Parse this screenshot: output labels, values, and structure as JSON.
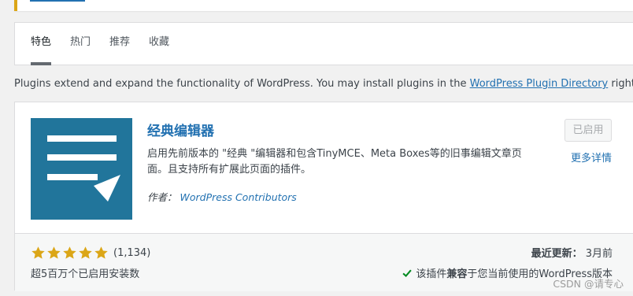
{
  "tabs": [
    {
      "label": "特色",
      "active": true
    },
    {
      "label": "热门",
      "active": false
    },
    {
      "label": "推荐",
      "active": false
    },
    {
      "label": "收藏",
      "active": false
    }
  ],
  "intro": {
    "text_before": "Plugins extend and expand the functionality of WordPress. You may install plugins in the ",
    "link_text": "WordPress Plugin Directory",
    "text_after": " right from here, or u"
  },
  "plugin": {
    "name": "经典编辑器",
    "description": "启用先前版本的 \"经典 \"编辑器和包含TinyMCE、Meta Boxes等的旧事编辑文章页面。且支持所有扩展此页面的插件。",
    "author_label": "作者：",
    "author_name": "WordPress Contributors",
    "status_button": "已启用",
    "more_details": "更多详情",
    "rating_stars": 5,
    "rating_count": "(1,134)",
    "installs": "超5百万个已启用安装数",
    "last_updated_label": "最近更新：",
    "last_updated_value": "3月前",
    "compat_prefix": "该插件",
    "compat_bold": "兼容",
    "compat_suffix": "于您当前使用的WordPress版本"
  },
  "watermark": "CSDN @请专心",
  "colors": {
    "link": "#2271b1",
    "icon_bg": "#21759b",
    "star": "#dba617",
    "check": "#008a20",
    "notice_border": "#dba617"
  },
  "icons": {
    "plugin_icon": "document-lines-icon",
    "star": "star-filled-icon",
    "check": "checkmark-icon"
  }
}
